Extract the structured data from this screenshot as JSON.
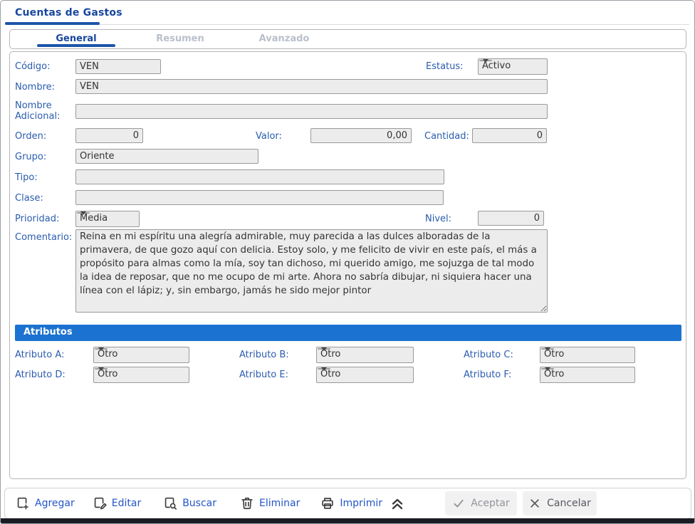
{
  "window": {
    "title": "Cuentas de Gastos"
  },
  "tabs": [
    {
      "label": "General",
      "active": true
    },
    {
      "label": "Resumen",
      "active": false
    },
    {
      "label": "Avanzado",
      "active": false
    }
  ],
  "form": {
    "codigo": {
      "label": "Código:",
      "value": "VEN"
    },
    "estatus": {
      "label": "Estatus:",
      "value": "Activo"
    },
    "nombre": {
      "label": "Nombre:",
      "value": "VEN"
    },
    "nombre_adicional": {
      "label": "Nombre Adicional:",
      "value": ""
    },
    "orden": {
      "label": "Orden:",
      "value": "0"
    },
    "valor": {
      "label": "Valor:",
      "value": "0,00"
    },
    "cantidad": {
      "label": "Cantidad:",
      "value": "0"
    },
    "grupo": {
      "label": "Grupo:",
      "value": "Oriente"
    },
    "tipo": {
      "label": "Tipo:",
      "value": ""
    },
    "clase": {
      "label": "Clase:",
      "value": ""
    },
    "prioridad": {
      "label": "Prioridad:",
      "value": "Media"
    },
    "nivel": {
      "label": "Nivel:",
      "value": "0"
    },
    "comentario": {
      "label": "Comentario:",
      "value": "Reina en mi espíritu una alegría admirable, muy parecida a las dulces alboradas de la primavera, de que gozo aquí con delicia. Estoy solo, y me felicito de vivir en este país, el más a propósito para almas como la mía, soy tan dichoso, mi querido amigo, me sojuzga de tal modo la idea de reposar, que no me ocupo de mi arte. Ahora no sabría dibujar, ni siquiera hacer una línea con el lápiz; y, sin embargo, jamás he sido mejor pintor"
    }
  },
  "atributos": {
    "header": "Atributos",
    "items": [
      {
        "label": "Atributo A:",
        "value": "Otro"
      },
      {
        "label": "Atributo B:",
        "value": "Otro"
      },
      {
        "label": "Atributo C:",
        "value": "Otro"
      },
      {
        "label": "Atributo D:",
        "value": "Otro"
      },
      {
        "label": "Atributo E:",
        "value": "Otro"
      },
      {
        "label": "Atributo F:",
        "value": "Otro"
      }
    ]
  },
  "toolbar": {
    "actions": [
      {
        "label": "Agregar",
        "icon": "add-document-icon"
      },
      {
        "label": "Editar",
        "icon": "edit-document-icon"
      },
      {
        "label": "Buscar",
        "icon": "search-document-icon"
      },
      {
        "label": "Eliminar",
        "icon": "trash-icon"
      },
      {
        "label": "Imprimir",
        "icon": "printer-icon"
      }
    ],
    "collapse_icon": "double-chevron-up-icon",
    "accept_label": "Aceptar",
    "cancel_label": "Cancelar"
  },
  "colors": {
    "accent_blue": "#1b72d0",
    "label_blue": "#2a5cae",
    "title_navy": "#17479e",
    "inactive_tab_gray": "#b9c0cb",
    "action_link_blue": "#2355c8",
    "input_bg": "#ececec",
    "bottom_bar_dark": "#1b1b23"
  }
}
